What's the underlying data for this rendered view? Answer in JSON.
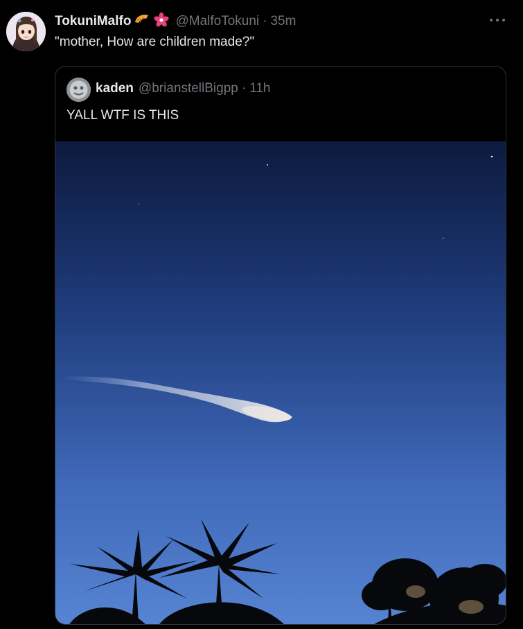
{
  "tweet": {
    "display_name": "TokuniMalfo",
    "emoji_1": "croissant-emoji",
    "emoji_2": "flower-emoji",
    "handle": "@MalfoTokuni",
    "separator": "·",
    "time": "35m",
    "text": "\"mother, How are children made?\""
  },
  "quote": {
    "display_name": "kaden",
    "handle": "@brianstellBigpp",
    "separator": "·",
    "time": "11h",
    "text": "YALL WTF IS THIS"
  },
  "colors": {
    "background": "#000000",
    "primary_text": "#e7e9ea",
    "secondary_text": "#71767b",
    "border": "#2f3336",
    "sky_top": "#0d1a3f",
    "sky_bottom": "#4d79c9"
  },
  "icons": {
    "more": "more-horizontal-icon"
  }
}
